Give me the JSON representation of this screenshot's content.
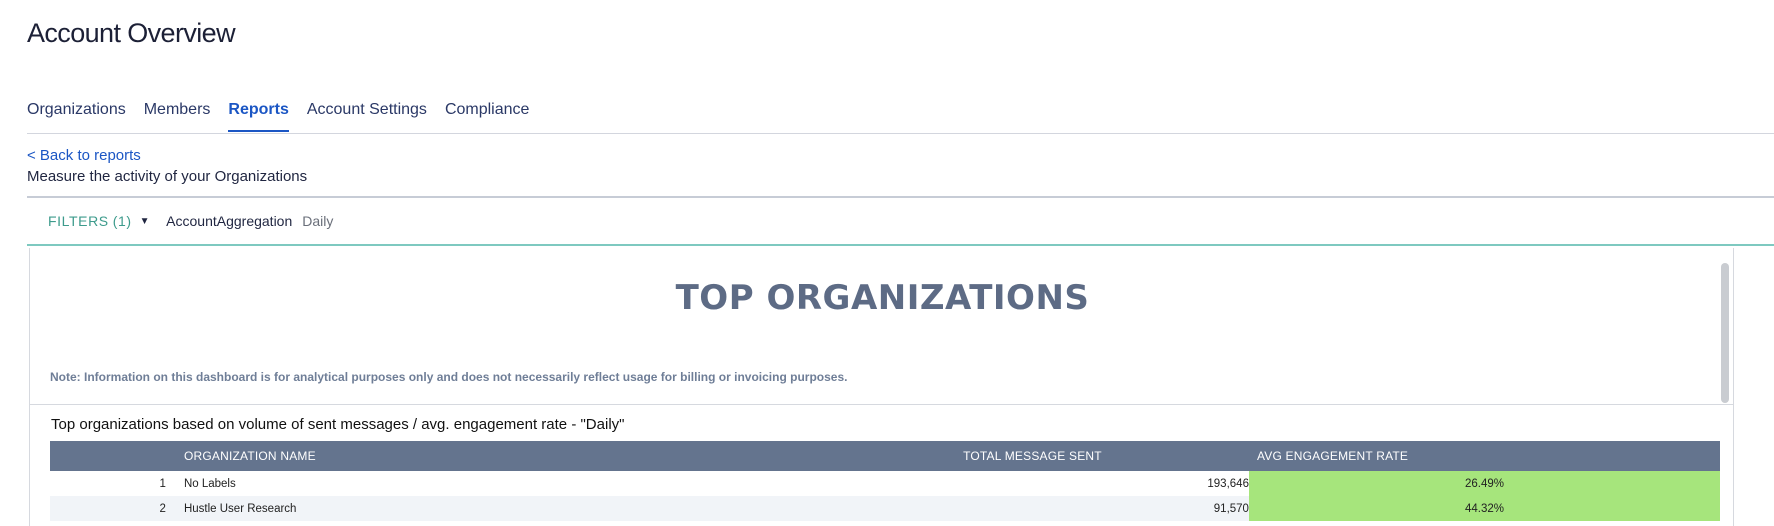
{
  "header": {
    "title": "Account Overview"
  },
  "tabs": [
    {
      "label": "Organizations",
      "active": false
    },
    {
      "label": "Members",
      "active": false
    },
    {
      "label": "Reports",
      "active": true
    },
    {
      "label": "Account Settings",
      "active": false
    },
    {
      "label": "Compliance",
      "active": false
    }
  ],
  "nav": {
    "back_label": "< Back to reports"
  },
  "page": {
    "subtitle": "Measure the activity of your Organizations"
  },
  "filters": {
    "label": "FILTERS",
    "count": "(1)",
    "caret_icon": "caret-down-icon",
    "filter_name": "AccountAggregation",
    "filter_value": "Daily"
  },
  "dashboard": {
    "title": "TOP ORGANIZATIONS",
    "note": "Note: Information on this dashboard is for analytical purposes only and does not necessarily reflect usage for billing or invoicing purposes.",
    "tile_title": "Top organizations based on volume of sent messages / avg. engagement rate - \"Daily\"",
    "table": {
      "columns": [
        "",
        "ORGANIZATION NAME",
        "TOTAL MESSAGE SENT",
        "AVG ENGAGEMENT RATE"
      ],
      "rows": [
        {
          "rank": "1",
          "name": "No Labels",
          "total": "193,646",
          "rate": "26.49%"
        },
        {
          "rank": "2",
          "name": "Hustle User Research",
          "total": "91,570",
          "rate": "44.32%"
        }
      ]
    }
  },
  "colors": {
    "accent": "#1b56c4",
    "filter_teal": "#3d9b8c",
    "header_slate": "#64748e",
    "rate_green": "#a6e57c"
  }
}
